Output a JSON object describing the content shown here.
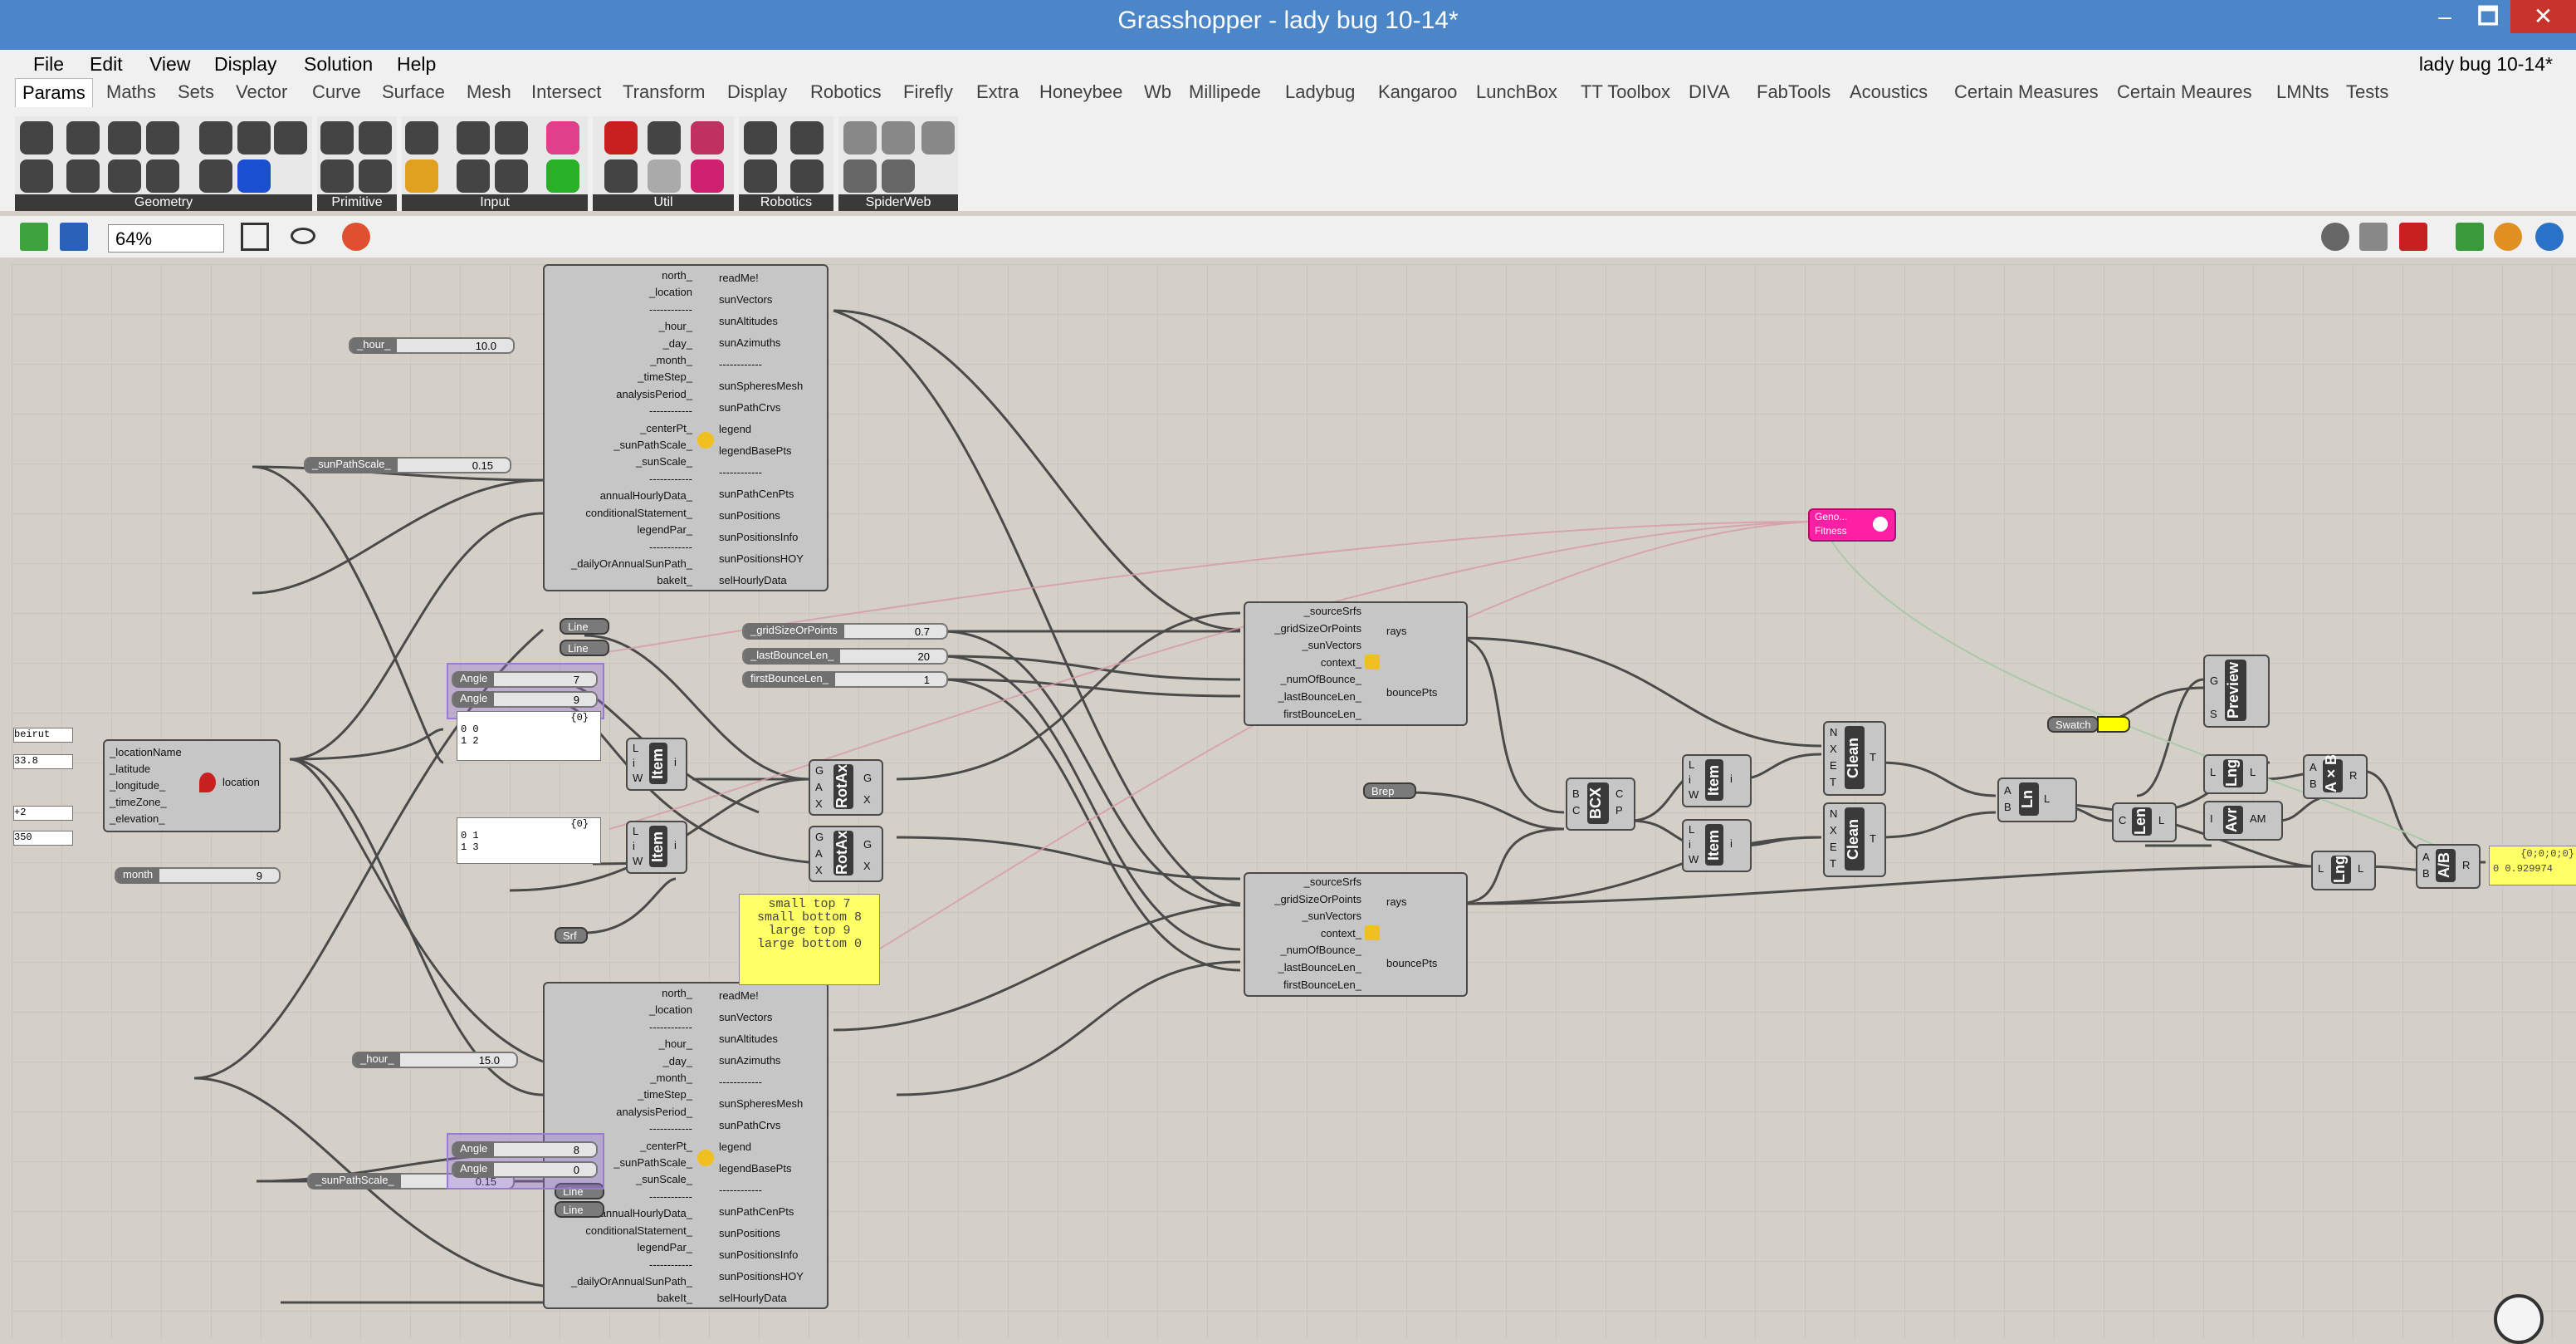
{
  "window": {
    "title": "Grasshopper - lady bug 10-14*",
    "min": "–",
    "max": "🗖",
    "close": "✕"
  },
  "menu": [
    "File",
    "Edit",
    "View",
    "Display",
    "Solution",
    "Help"
  ],
  "doc_label": "lady bug 10-14*",
  "tabs": [
    "Params",
    "Maths",
    "Sets",
    "Vector",
    "Curve",
    "Surface",
    "Mesh",
    "Intersect",
    "Transform",
    "Display",
    "Robotics",
    "Firefly",
    "Extra",
    "Honeybee",
    "Wb",
    "Millipede",
    "Ladybug",
    "Kangaroo",
    "LunchBox",
    "TT Toolbox",
    "DIVA",
    "FabTools",
    "Acoustics",
    "Certain Measures",
    "Certain Meaures",
    "LMNts",
    "Tests"
  ],
  "ribbon_groups": [
    "Geometry",
    "Primitive",
    "Input",
    "Util",
    "Robotics",
    "SpiderWeb"
  ],
  "zoom": "64%",
  "colors": {
    "titlebar": "#4a86c8",
    "close": "#c8342c",
    "gene": "#ff1fa5",
    "yellow_panel": "#ffff66",
    "swatch": "#ffff00"
  },
  "sunpath": {
    "inputs": [
      "north_",
      "_location",
      "------------",
      "_hour_",
      "_day_",
      "_month_",
      "_timeStep_",
      "analysisPeriod_",
      "------------",
      "_centerPt_",
      "_sunPathScale_",
      "_sunScale_",
      "------------",
      "annualHourlyData_",
      "conditionalStatement_",
      "legendPar_",
      "------------",
      "_dailyOrAnnualSunPath_",
      "bakeIt_"
    ],
    "outputs": [
      "readMe!",
      "sunVectors",
      "sunAltitudes",
      "sunAzimuths",
      "------------",
      "sunSpheresMesh",
      "sunPathCrvs",
      "legend",
      "legendBasePts",
      "------------",
      "sunPathCenPts",
      "sunPositions",
      "sunPositionsInfo",
      "sunPositionsHOY",
      "selHourlyData"
    ]
  },
  "sliders": {
    "hour1": {
      "name": "_hour_",
      "value": "10.0"
    },
    "scale1": {
      "name": "_sunPathScale_",
      "value": "0.15"
    },
    "hour2": {
      "name": "_hour_",
      "value": "15.0"
    },
    "scale2": {
      "name": "_sunPathScale_",
      "value": "0.15"
    },
    "month": {
      "name": "month",
      "value": "9"
    },
    "angle1": {
      "name": "Angle",
      "value": "7"
    },
    "angle2": {
      "name": "Angle",
      "value": "9"
    },
    "angle3": {
      "name": "Angle",
      "value": "8"
    },
    "angle4": {
      "name": "Angle",
      "value": "0"
    },
    "grid": {
      "name": "_gridSizeOrPoints",
      "value": "0.7"
    },
    "lastb": {
      "name": "_lastBounceLen_",
      "value": "20"
    },
    "firstb": {
      "name": "firstBounceLen_",
      "value": "1"
    }
  },
  "location": {
    "inputs": [
      "_locationName",
      "_latitude",
      "_longitude_",
      "_timeZone_",
      "_elevation_"
    ],
    "output": "location",
    "values": [
      "beirut",
      "33.8",
      "",
      "+2",
      "350"
    ]
  },
  "params": {
    "line": "Line",
    "srf": "Srf",
    "brep": "Brep",
    "swatch": "Swatch"
  },
  "panels": {
    "p1_header": "{0}",
    "p1_rows": [
      "0 0",
      "1 2"
    ],
    "p2_header": "{0}",
    "p2_rows": [
      "0 1",
      "1 3"
    ]
  },
  "note": [
    "small top 7",
    "small bottom 8",
    "",
    "large top 9",
    "large bottom 0"
  ],
  "raytrace": {
    "inputs": [
      "_sourceSrfs",
      "_gridSizeOrPoints",
      "_sunVectors",
      "context_",
      "_numOfBounce_",
      "_lastBounceLen_",
      "firstBounceLen_"
    ],
    "outputs": [
      "rays",
      "bouncePts"
    ]
  },
  "rotax": {
    "label": "RotAx",
    "inputs": [
      "G",
      "A",
      "X"
    ],
    "outputs": [
      "G",
      "X"
    ]
  },
  "item": {
    "label": "Item",
    "inputs": [
      "L",
      "i",
      "W"
    ],
    "output": "i"
  },
  "bcx": {
    "label": "BCX",
    "inputs": [
      "B",
      "C"
    ],
    "outputs": [
      "C",
      "P"
    ]
  },
  "clean": {
    "label": "Clean",
    "inputs": [
      "N",
      "X",
      "E",
      "T"
    ],
    "output": "T"
  },
  "ln": {
    "label": "Ln",
    "inputs": [
      "A",
      "B"
    ],
    "output": "L"
  },
  "len": {
    "label": "Len",
    "inputs": [
      "C"
    ],
    "output": "L"
  },
  "lng": {
    "label": "Lng",
    "inputs": [
      "L"
    ],
    "output": "L"
  },
  "avr": {
    "label": "Avr",
    "inputs": [
      "I"
    ],
    "output": "AM"
  },
  "axb": {
    "label": "A×B",
    "inputs": [
      "A",
      "B"
    ],
    "output": "R"
  },
  "adivb": {
    "label": "A/B",
    "inputs": [
      "A",
      "B"
    ],
    "output": "R"
  },
  "preview": {
    "label": "Preview",
    "inputs": [
      "G",
      "S"
    ]
  },
  "gene": {
    "lines": [
      "Geno...",
      "Fitness"
    ]
  },
  "result": [
    "{0;0;0;0}",
    "0 0.929974"
  ]
}
